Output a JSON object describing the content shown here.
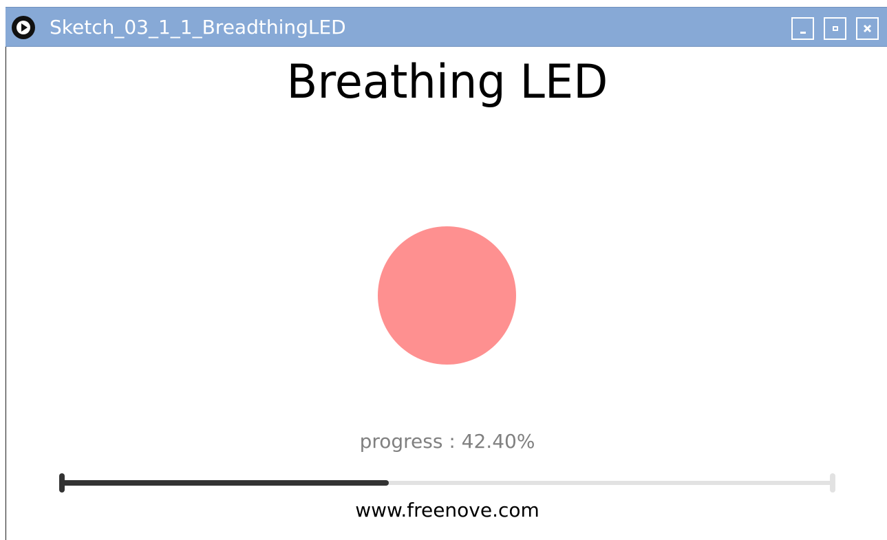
{
  "window": {
    "title": "Sketch_03_1_1_BreadthingLED",
    "app_icon": "play-icon",
    "controls": {
      "minimize_icon": "minimize-icon",
      "maximize_icon": "maximize-icon",
      "close_icon": "close-icon"
    },
    "titlebar_color": "#87a9d6"
  },
  "main": {
    "heading": "Breathing LED",
    "led_color": "#fe9090",
    "progress_label": "progress : 42.40%",
    "progress_value": 0.424,
    "footer": "www.freenove.com"
  }
}
